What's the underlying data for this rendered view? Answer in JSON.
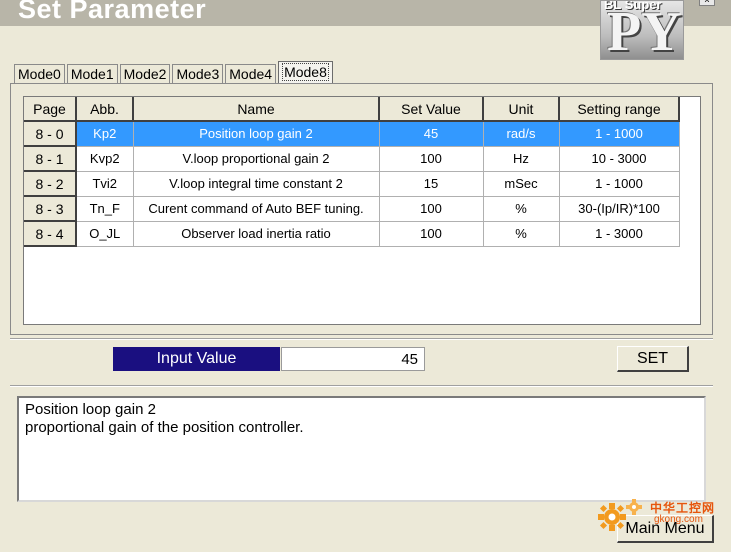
{
  "window": {
    "title": "Set Parameter",
    "close_glyph": "x"
  },
  "logo": {
    "sub": "BL Super",
    "main": "PY"
  },
  "tabs": [
    {
      "label": "Mode0",
      "active": false
    },
    {
      "label": "Mode1",
      "active": false
    },
    {
      "label": "Mode2",
      "active": false
    },
    {
      "label": "Mode3",
      "active": false
    },
    {
      "label": "Mode4",
      "active": false
    },
    {
      "label": "Mode8",
      "active": true
    }
  ],
  "table": {
    "headers": [
      "Page",
      "Abb.",
      "Name",
      "Set Value",
      "Unit",
      "Setting range"
    ],
    "selected_row": 0,
    "rows": [
      {
        "page": "8 - 0",
        "abb": "Kp2",
        "name": "Position loop gain 2",
        "value": "45",
        "unit": "rad/s",
        "range": "1 - 1000"
      },
      {
        "page": "8 - 1",
        "abb": "Kvp2",
        "name": "V.loop proportional gain 2",
        "value": "100",
        "unit": "Hz",
        "range": "10 - 3000"
      },
      {
        "page": "8 - 2",
        "abb": "Tvi2",
        "name": "V.loop integral time constant 2",
        "value": "15",
        "unit": "mSec",
        "range": "1 - 1000"
      },
      {
        "page": "8 - 3",
        "abb": "Tn_F",
        "name": "Curent command of Auto BEF tuning.",
        "value": "100",
        "unit": "%",
        "range": "30-(Ip/IR)*100"
      },
      {
        "page": "8 - 4",
        "abb": "O_JL",
        "name": "Observer load inertia ratio",
        "value": "100",
        "unit": "%",
        "range": "1 - 3000"
      }
    ]
  },
  "input": {
    "label": "Input Value",
    "value": "45"
  },
  "set_button": "SET",
  "description": {
    "line1": "Position loop gain 2",
    "line2": "proportional gain of the position controller."
  },
  "main_menu_button": "Main Menu",
  "watermark": {
    "cn": "中华工控网",
    "url": "gkong.com"
  },
  "colors": {
    "selected_row": "#3399ff",
    "input_label_bg": "#1a0f80",
    "background": "#ece9d8"
  }
}
